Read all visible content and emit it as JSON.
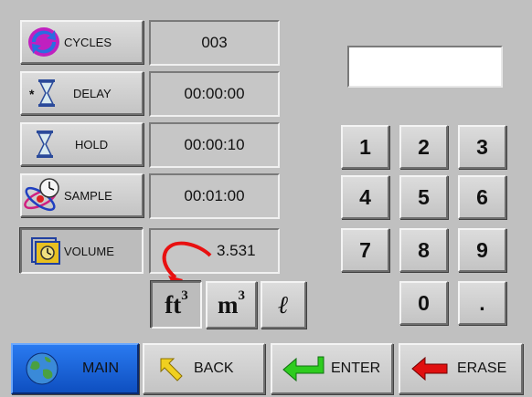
{
  "params": [
    {
      "label": "CYCLES",
      "value": "003",
      "icon": "cycles-icon"
    },
    {
      "label": "DELAY",
      "value": "00:00:00",
      "icon": "hourglass-delay-icon"
    },
    {
      "label": "HOLD",
      "value": "00:00:10",
      "icon": "hourglass-icon"
    },
    {
      "label": "SAMPLE",
      "value": "00:01:00",
      "icon": "sample-clock-icon"
    },
    {
      "label": "VOLUME",
      "value": "3.531",
      "icon": "volume-icon"
    }
  ],
  "units": {
    "ft3": "ft",
    "m3": "m",
    "exp": "3",
    "liter": "ℓ",
    "selected": "ft3"
  },
  "keypad": [
    "1",
    "2",
    "3",
    "4",
    "5",
    "6",
    "7",
    "8",
    "9",
    "0",
    "."
  ],
  "display_value": "",
  "nav": [
    {
      "label": "MAIN",
      "icon": "globe-icon"
    },
    {
      "label": "BACK",
      "icon": "back-arrow-icon"
    },
    {
      "label": "ENTER",
      "icon": "enter-arrow-icon"
    },
    {
      "label": "ERASE",
      "icon": "erase-arrow-icon"
    }
  ],
  "colors": {
    "main_button": "#1565d8",
    "enter_arrow": "#2ecc1f",
    "erase_arrow": "#e01010",
    "back_arrow": "#f0d020",
    "annotation_arrow": "#e81010"
  }
}
